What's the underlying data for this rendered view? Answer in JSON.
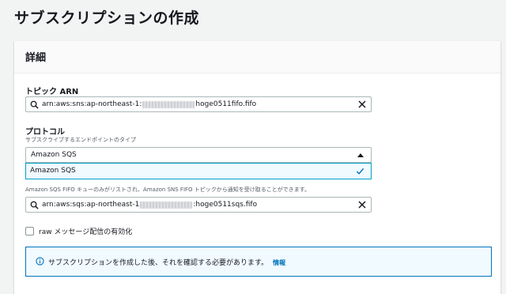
{
  "page": {
    "title": "サブスクリプションの作成"
  },
  "details": {
    "title": "詳細",
    "topic_arn": {
      "label": "トピック ARN",
      "value_prefix": "arn:aws:sns:ap-northeast-1:",
      "value_suffix": "hoge0511fifo.fifo"
    },
    "protocol": {
      "label": "プロトコル",
      "description": "サブスクライブするエンドポイントのタイプ",
      "selected": "Amazon SQS",
      "options": [
        "Amazon SQS"
      ]
    },
    "endpoint": {
      "description": "Amazon SQS FIFO キューのみがリストされ、Amazon SNS FIFO トピックから通知を受け取ることができます。",
      "value_prefix": "arn:aws:sqs:ap-northeast-1",
      "value_suffix": ":hoge0511sqs.fifo"
    },
    "raw_delivery": {
      "label": "raw メッセージ配信の有効化",
      "checked": false
    },
    "info_alert": {
      "message": "サブスクリプションを作成した後、それを確認する必要があります。",
      "link": "情報"
    }
  },
  "colors": {
    "accent": "#0073bb",
    "selection": "#00a1c9",
    "text": "#16191f"
  }
}
